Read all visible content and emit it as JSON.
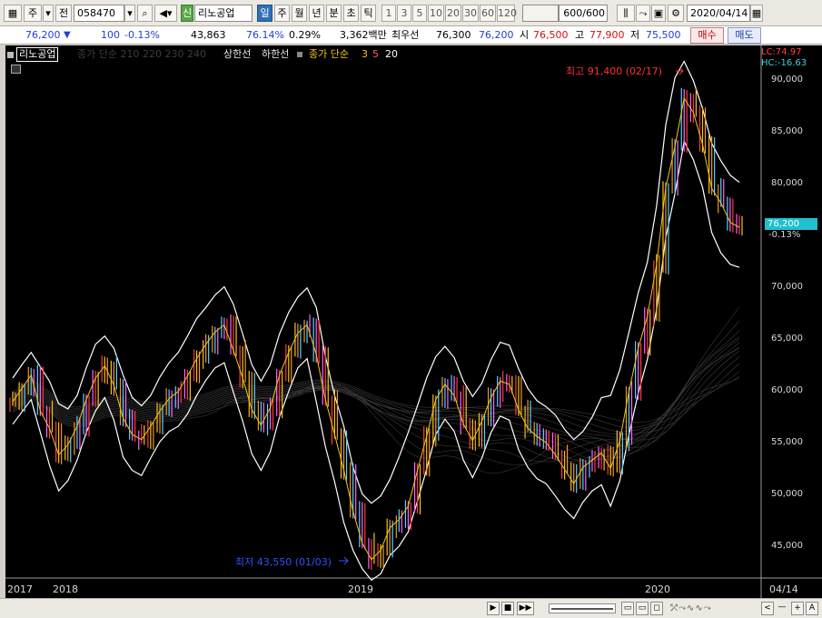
{
  "toolbar": {
    "market_label": "주",
    "mode_label": "전",
    "code": "058470",
    "stock_name": "리노공업",
    "stock_prefix": "신",
    "periods": [
      "일",
      "주",
      "월",
      "년",
      "분",
      "초",
      "틱"
    ],
    "active_period": "일",
    "intervals": [
      "1",
      "3",
      "5",
      "10",
      "20",
      "30",
      "60",
      "120"
    ],
    "count_value": "600",
    "count_total": "/600",
    "date": "2020/04/14"
  },
  "quote": {
    "price": "76,200",
    "change": "100",
    "change_pct": "-0.13%",
    "volume": "43,863",
    "turnover_pct": "76.14%",
    "ratio_pct": "0.29%",
    "amount": "3,362백만",
    "best_ask_label": "최우선",
    "best_ask": "76,300",
    "best_bid": "76,200",
    "open_label": "시",
    "open": "76,500",
    "high_label": "고",
    "high": "77,900",
    "low_label": "저",
    "low": "75,500",
    "buy_label": "매수",
    "sell_label": "매도"
  },
  "legend": {
    "name": "리노공업",
    "ma_dim": "종가 단순 210  220  230  240",
    "upper_limit": "상한선",
    "lower_limit": "하한선",
    "ma_label": "종가 단순",
    "ma_periods": [
      "3",
      "5",
      "20"
    ]
  },
  "chart_info": {
    "lc": "LC:74.97",
    "hc": "HC:-16.63",
    "current_price": "76,200",
    "current_change": "-0.13%",
    "high_annotation": "최고 91,400 (02/17)",
    "low_annotation": "최저 43,550 (01/03)"
  },
  "chart_data": {
    "type": "line",
    "yaxis": [
      "90,000",
      "85,000",
      "80,000",
      "75,000",
      "70,000",
      "65,000",
      "60,000",
      "55,000",
      "50,000",
      "45,000"
    ],
    "xaxis": [
      "2017",
      "2018",
      "2019",
      "2020",
      "04/14"
    ],
    "ylim": [
      42000,
      92000
    ],
    "close_series": [
      59200,
      60500,
      61800,
      58300,
      56600,
      54000,
      55000,
      56800,
      59400,
      61500,
      62700,
      60800,
      57600,
      56000,
      55500,
      56800,
      58300,
      59500,
      60200,
      61700,
      63400,
      64800,
      66000,
      66700,
      64200,
      61500,
      58400,
      56900,
      58600,
      61800,
      64000,
      65900,
      66700,
      63800,
      59400,
      56000,
      52500,
      48500,
      45400,
      43800,
      44700,
      46900,
      47700,
      49000,
      52500,
      55800,
      59400,
      60900,
      59800,
      57000,
      55400,
      57300,
      59600,
      61200,
      60900,
      58400,
      56600,
      55800,
      55200,
      54000,
      52600,
      51200,
      52800,
      53500,
      54200,
      52700,
      55400,
      60200,
      64400,
      67500,
      72600,
      80100,
      84100,
      88800,
      87400,
      84300,
      80000,
      78600,
      76700,
      76200
    ],
    "upper_series": [
      61500,
      62800,
      64000,
      62600,
      61200,
      59000,
      58500,
      59800,
      62500,
      64800,
      65600,
      64400,
      61800,
      59600,
      58800,
      59800,
      61600,
      63000,
      64000,
      65600,
      67300,
      68400,
      69600,
      70400,
      68700,
      65800,
      62800,
      61200,
      62800,
      65800,
      67900,
      69400,
      70300,
      68400,
      63600,
      59800,
      56800,
      52800,
      50200,
      49300,
      50000,
      51600,
      53800,
      56200,
      58800,
      61500,
      63600,
      64600,
      63500,
      61200,
      59700,
      61000,
      63300,
      65000,
      64700,
      62400,
      60500,
      59300,
      58700,
      57900,
      56500,
      55500,
      56300,
      57700,
      59600,
      59800,
      62300,
      66000,
      69800,
      72800,
      78300,
      86200,
      90800,
      92400,
      90500,
      87800,
      84400,
      82700,
      81300,
      80600
    ],
    "lower_series": [
      57000,
      58200,
      59400,
      56200,
      53000,
      50500,
      51500,
      53500,
      56200,
      58300,
      59600,
      57400,
      53800,
      52500,
      52000,
      53700,
      55300,
      56300,
      56800,
      58000,
      59800,
      61300,
      62500,
      63000,
      60100,
      57300,
      54100,
      52500,
      54300,
      57700,
      60200,
      62500,
      63400,
      59200,
      54800,
      51400,
      47400,
      44700,
      42900,
      41800,
      42400,
      44200,
      45100,
      46500,
      49500,
      52600,
      56000,
      57500,
      56300,
      53500,
      51800,
      53700,
      56200,
      57800,
      57400,
      54500,
      52800,
      51700,
      51200,
      50000,
      48700,
      47800,
      49400,
      50500,
      51100,
      49000,
      51500,
      56000,
      60000,
      63300,
      68200,
      75200,
      79500,
      84600,
      82800,
      80100,
      75700,
      73700,
      72600,
      72300
    ]
  },
  "status": {
    "buttons": [
      "▶",
      "■",
      "▶▶",
      "<",
      "+",
      "A"
    ]
  }
}
